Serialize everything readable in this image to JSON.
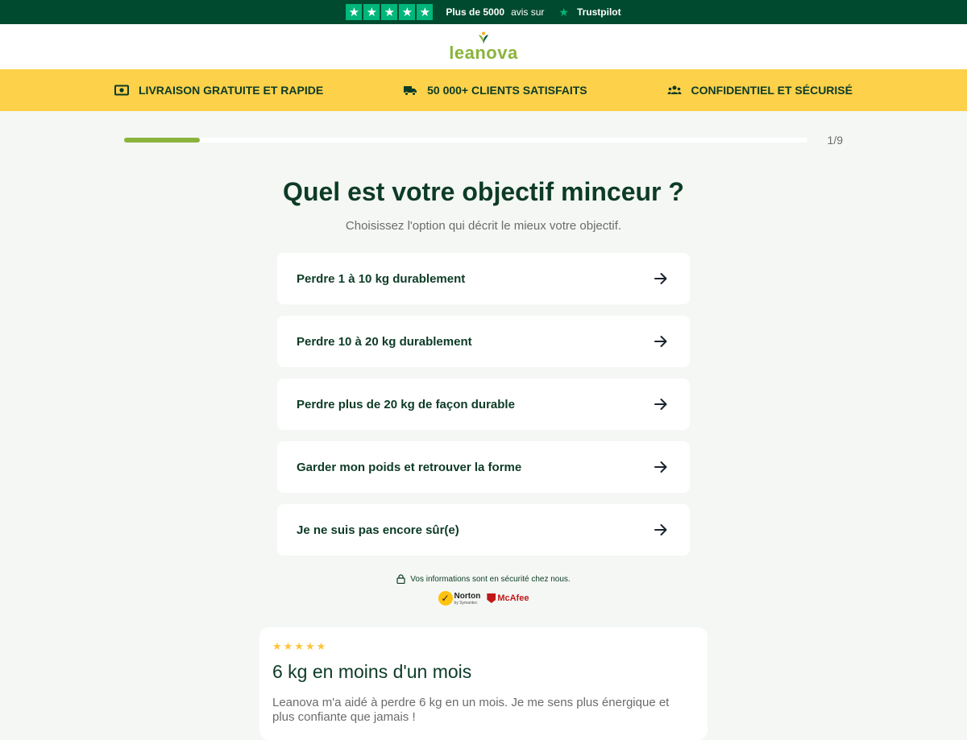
{
  "topbar": {
    "stars_count": 5,
    "prefix_bold": "Plus de 5000",
    "prefix_rest": "avis sur",
    "trustpilot": "Trustpilot"
  },
  "brand": {
    "name": "leanova",
    "color": "#8ab43c"
  },
  "benefits": [
    {
      "icon": "cash-icon",
      "label": "LIVRAISON GRATUITE ET RAPIDE"
    },
    {
      "icon": "truck-icon",
      "label": "50 000+ CLIENTS SATISFAITS"
    },
    {
      "icon": "people-icon",
      "label": "CONFIDENTIEL ET SÉCURISÉ"
    }
  ],
  "progress": {
    "label": "1/9",
    "fraction": 0.1111
  },
  "question": {
    "title": "Quel est votre objectif minceur ?",
    "subtitle": "Choisissez l'option qui décrit le mieux votre objectif."
  },
  "options": [
    {
      "label": "Perdre 1 à 10 kg durablement"
    },
    {
      "label": "Perdre 10 à 20 kg durablement"
    },
    {
      "label": "Perdre plus de 20 kg de façon durable"
    },
    {
      "label": "Garder mon poids et retrouver la forme"
    },
    {
      "label": "Je ne suis pas encore sûr(e)"
    }
  ],
  "security": {
    "text": "Vos informations sont en sécurité chez nous.",
    "norton": "Norton",
    "norton_sub": "by Symantec",
    "mcafee": "McAfee"
  },
  "review": {
    "stars": "★★★★★",
    "title": "6 kg en moins d'un mois",
    "text": "Leanova m'a aidé à perdre 6 kg en un mois. Je me sens plus énergique et plus confiante que jamais !"
  },
  "colors": {
    "dark_green": "#004a2f",
    "yellow": "#fdd14a",
    "accent_green": "#8ab43c",
    "trustpilot_green": "#00b67a"
  }
}
